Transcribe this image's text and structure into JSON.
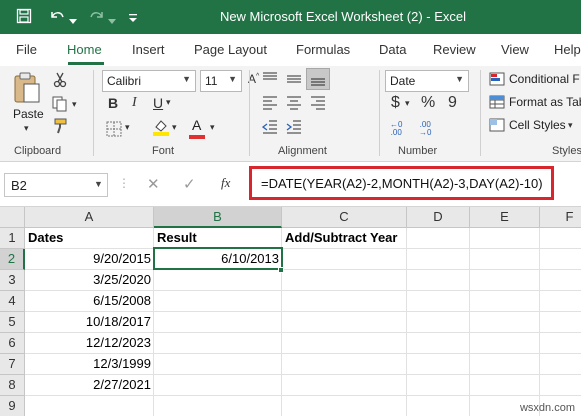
{
  "window": {
    "title": "New Microsoft Excel Worksheet (2)  -  Excel"
  },
  "tabs": [
    "File",
    "Home",
    "Insert",
    "Page Layout",
    "Formulas",
    "Data",
    "Review",
    "View",
    "Help"
  ],
  "active_tab": "Home",
  "ribbon": {
    "clipboard": {
      "paste_label": "Paste",
      "group_label": "Clipboard"
    },
    "font": {
      "font_name": "Calibri",
      "font_size": "11",
      "group_label": "Font",
      "bold": "B",
      "italic": "I",
      "underline": "U",
      "font_color_letter": "A"
    },
    "alignment": {
      "group_label": "Alignment"
    },
    "number": {
      "format": "Date",
      "currency": "$",
      "percent": "%",
      "comma": "9",
      "group_label": "Number"
    },
    "styles": {
      "conditional_formatting": "Conditional F",
      "format_as_table": "Format as Tab",
      "cell_styles": "Cell Styles",
      "group_label": "Styles"
    }
  },
  "formula_bar": {
    "name_box": "B2",
    "fx": "fx",
    "formula": "=DATE(YEAR(A2)-2,MONTH(A2)-3,DAY(A2)-10)"
  },
  "columns": [
    "A",
    "B",
    "C",
    "D",
    "E",
    "F"
  ],
  "rows": [
    "1",
    "2",
    "3",
    "4",
    "5",
    "6",
    "7",
    "8",
    "9"
  ],
  "cells": {
    "A1": "Dates",
    "B1": "Result",
    "C1": "Add/Subtract Year",
    "A2": "9/20/2015",
    "B2": "6/10/2013",
    "A3": "3/25/2020",
    "A4": "6/15/2008",
    "A5": "10/18/2017",
    "A6": "12/12/2023",
    "A7": "12/3/1999",
    "A8": "2/27/2021"
  },
  "selected_cell": "B2",
  "watermark": "wsxdn.com",
  "colors": {
    "excel_green": "#217346",
    "highlight_red": "#d8262f",
    "font_color_red": "#e03030",
    "highlight_yellow": "#ffe600"
  }
}
